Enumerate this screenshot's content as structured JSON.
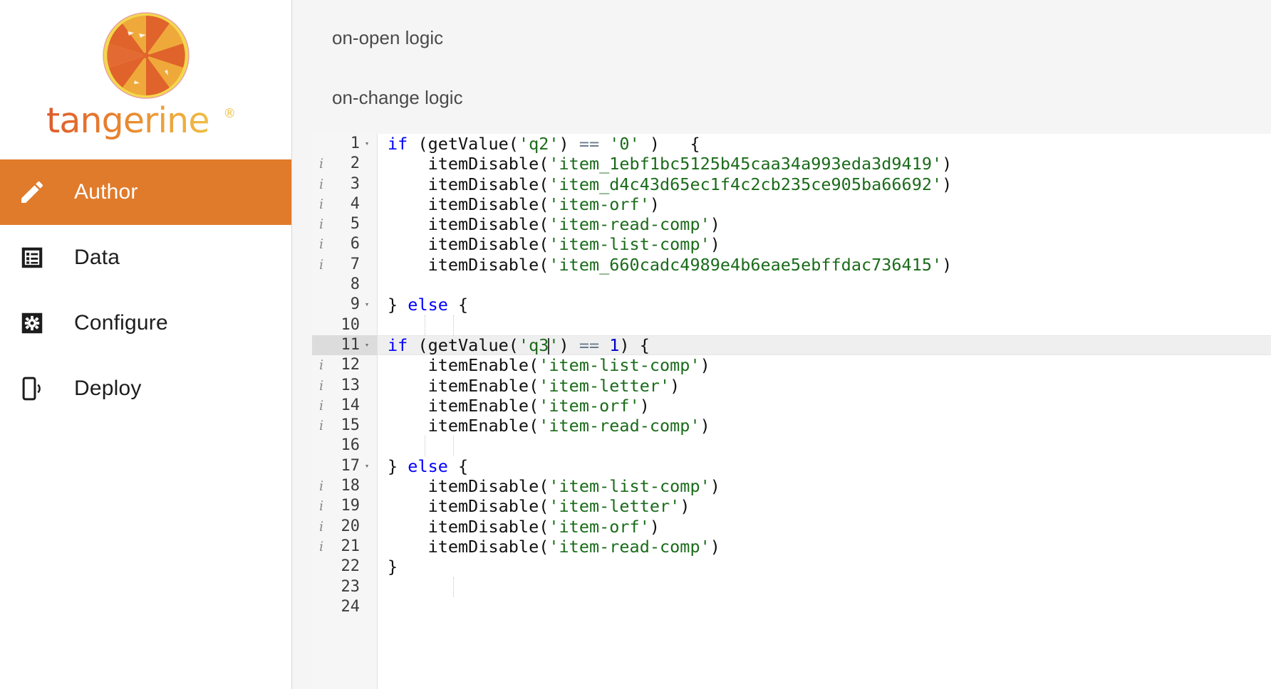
{
  "brand": {
    "wordmark": "tangerine",
    "registered": "®",
    "colors": {
      "orange": "#E0632B",
      "amber": "#EFA93A",
      "yellow": "#F2D04B",
      "accent": "#E07B2B"
    }
  },
  "sidebar": {
    "items": [
      {
        "label": "Author",
        "icon": "pencil-icon",
        "active": true
      },
      {
        "label": "Data",
        "icon": "list-box-icon",
        "active": false
      },
      {
        "label": "Configure",
        "icon": "gear-box-icon",
        "active": false
      },
      {
        "label": "Deploy",
        "icon": "mobile-signal-icon",
        "active": false
      }
    ]
  },
  "main": {
    "labels": [
      {
        "text": "on-open logic"
      },
      {
        "text": "on-change logic"
      }
    ]
  },
  "editor": {
    "active_line": 11,
    "cursor_after": "q3",
    "syntax_colors": {
      "keyword": "#0000ff",
      "string": "#1a6b1a",
      "number": "#0000cd",
      "operator": "#6a7a8c",
      "text": "#111111",
      "active_line_bg": "#efefef",
      "gutter_bg": "#f6f6f6"
    },
    "lines": [
      {
        "n": 1,
        "info": false,
        "fold": true,
        "active": false,
        "tokens": [
          {
            "t": "if",
            "c": "kw"
          },
          {
            "t": " (getValue(",
            "c": "punc"
          },
          {
            "t": "'q2'",
            "c": "str"
          },
          {
            "t": ") ",
            "c": "punc"
          },
          {
            "t": "==",
            "c": "op"
          },
          {
            "t": " ",
            "c": "punc"
          },
          {
            "t": "'0'",
            "c": "str"
          },
          {
            "t": " )   {",
            "c": "punc"
          }
        ]
      },
      {
        "n": 2,
        "info": true,
        "fold": false,
        "active": false,
        "tokens": [
          {
            "t": "    itemDisable(",
            "c": "punc"
          },
          {
            "t": "'item_1ebf1bc5125b45caa34a993eda3d9419'",
            "c": "str"
          },
          {
            "t": ")",
            "c": "punc"
          }
        ]
      },
      {
        "n": 3,
        "info": true,
        "fold": false,
        "active": false,
        "tokens": [
          {
            "t": "    itemDisable(",
            "c": "punc"
          },
          {
            "t": "'item_d4c43d65ec1f4c2cb235ce905ba66692'",
            "c": "str"
          },
          {
            "t": ")",
            "c": "punc"
          }
        ]
      },
      {
        "n": 4,
        "info": true,
        "fold": false,
        "active": false,
        "tokens": [
          {
            "t": "    itemDisable(",
            "c": "punc"
          },
          {
            "t": "'item-orf'",
            "c": "str"
          },
          {
            "t": ")",
            "c": "punc"
          }
        ]
      },
      {
        "n": 5,
        "info": true,
        "fold": false,
        "active": false,
        "tokens": [
          {
            "t": "    itemDisable(",
            "c": "punc"
          },
          {
            "t": "'item-read-comp'",
            "c": "str"
          },
          {
            "t": ")",
            "c": "punc"
          }
        ]
      },
      {
        "n": 6,
        "info": true,
        "fold": false,
        "active": false,
        "tokens": [
          {
            "t": "    itemDisable(",
            "c": "punc"
          },
          {
            "t": "'item-list-comp'",
            "c": "str"
          },
          {
            "t": ")",
            "c": "punc"
          }
        ]
      },
      {
        "n": 7,
        "info": true,
        "fold": false,
        "active": false,
        "tokens": [
          {
            "t": "    itemDisable(",
            "c": "punc"
          },
          {
            "t": "'item_660cadc4989e4b6eae5ebffdac736415'",
            "c": "str"
          },
          {
            "t": ")",
            "c": "punc"
          }
        ]
      },
      {
        "n": 8,
        "info": false,
        "fold": false,
        "active": false,
        "tokens": []
      },
      {
        "n": 9,
        "info": false,
        "fold": true,
        "active": false,
        "tokens": [
          {
            "t": "} ",
            "c": "punc"
          },
          {
            "t": "else",
            "c": "kw"
          },
          {
            "t": " {",
            "c": "punc"
          }
        ]
      },
      {
        "n": 10,
        "info": false,
        "fold": false,
        "active": false,
        "tokens": []
      },
      {
        "n": 11,
        "info": false,
        "fold": true,
        "active": true,
        "tokens": [
          {
            "t": "if",
            "c": "kw"
          },
          {
            "t": " (getValue(",
            "c": "punc"
          },
          {
            "t": "'q3",
            "c": "str"
          },
          {
            "t": "CARET",
            "c": "caret"
          },
          {
            "t": "'",
            "c": "str"
          },
          {
            "t": ") ",
            "c": "punc"
          },
          {
            "t": "==",
            "c": "op"
          },
          {
            "t": " ",
            "c": "punc"
          },
          {
            "t": "1",
            "c": "num"
          },
          {
            "t": ") {",
            "c": "punc"
          }
        ]
      },
      {
        "n": 12,
        "info": true,
        "fold": false,
        "active": false,
        "tokens": [
          {
            "t": "    itemEnable(",
            "c": "punc"
          },
          {
            "t": "'item-list-comp'",
            "c": "str"
          },
          {
            "t": ")",
            "c": "punc"
          }
        ]
      },
      {
        "n": 13,
        "info": true,
        "fold": false,
        "active": false,
        "tokens": [
          {
            "t": "    itemEnable(",
            "c": "punc"
          },
          {
            "t": "'item-letter'",
            "c": "str"
          },
          {
            "t": ")",
            "c": "punc"
          }
        ]
      },
      {
        "n": 14,
        "info": true,
        "fold": false,
        "active": false,
        "tokens": [
          {
            "t": "    itemEnable(",
            "c": "punc"
          },
          {
            "t": "'item-orf'",
            "c": "str"
          },
          {
            "t": ")",
            "c": "punc"
          }
        ]
      },
      {
        "n": 15,
        "info": true,
        "fold": false,
        "active": false,
        "tokens": [
          {
            "t": "    itemEnable(",
            "c": "punc"
          },
          {
            "t": "'item-read-comp'",
            "c": "str"
          },
          {
            "t": ")",
            "c": "punc"
          }
        ]
      },
      {
        "n": 16,
        "info": false,
        "fold": false,
        "active": false,
        "tokens": []
      },
      {
        "n": 17,
        "info": false,
        "fold": true,
        "active": false,
        "tokens": [
          {
            "t": "} ",
            "c": "punc"
          },
          {
            "t": "else",
            "c": "kw"
          },
          {
            "t": " {",
            "c": "punc"
          }
        ]
      },
      {
        "n": 18,
        "info": true,
        "fold": false,
        "active": false,
        "tokens": [
          {
            "t": "    itemDisable(",
            "c": "punc"
          },
          {
            "t": "'item-list-comp'",
            "c": "str"
          },
          {
            "t": ")",
            "c": "punc"
          }
        ]
      },
      {
        "n": 19,
        "info": true,
        "fold": false,
        "active": false,
        "tokens": [
          {
            "t": "    itemDisable(",
            "c": "punc"
          },
          {
            "t": "'item-letter'",
            "c": "str"
          },
          {
            "t": ")",
            "c": "punc"
          }
        ]
      },
      {
        "n": 20,
        "info": true,
        "fold": false,
        "active": false,
        "tokens": [
          {
            "t": "    itemDisable(",
            "c": "punc"
          },
          {
            "t": "'item-orf'",
            "c": "str"
          },
          {
            "t": ")",
            "c": "punc"
          }
        ]
      },
      {
        "n": 21,
        "info": true,
        "fold": false,
        "active": false,
        "tokens": [
          {
            "t": "    itemDisable(",
            "c": "punc"
          },
          {
            "t": "'item-read-comp'",
            "c": "str"
          },
          {
            "t": ")",
            "c": "punc"
          }
        ]
      },
      {
        "n": 22,
        "info": false,
        "fold": false,
        "active": false,
        "tokens": [
          {
            "t": "}",
            "c": "punc"
          }
        ]
      },
      {
        "n": 23,
        "info": false,
        "fold": false,
        "active": false,
        "tokens": []
      },
      {
        "n": 24,
        "info": false,
        "fold": false,
        "active": false,
        "tokens": []
      }
    ]
  }
}
